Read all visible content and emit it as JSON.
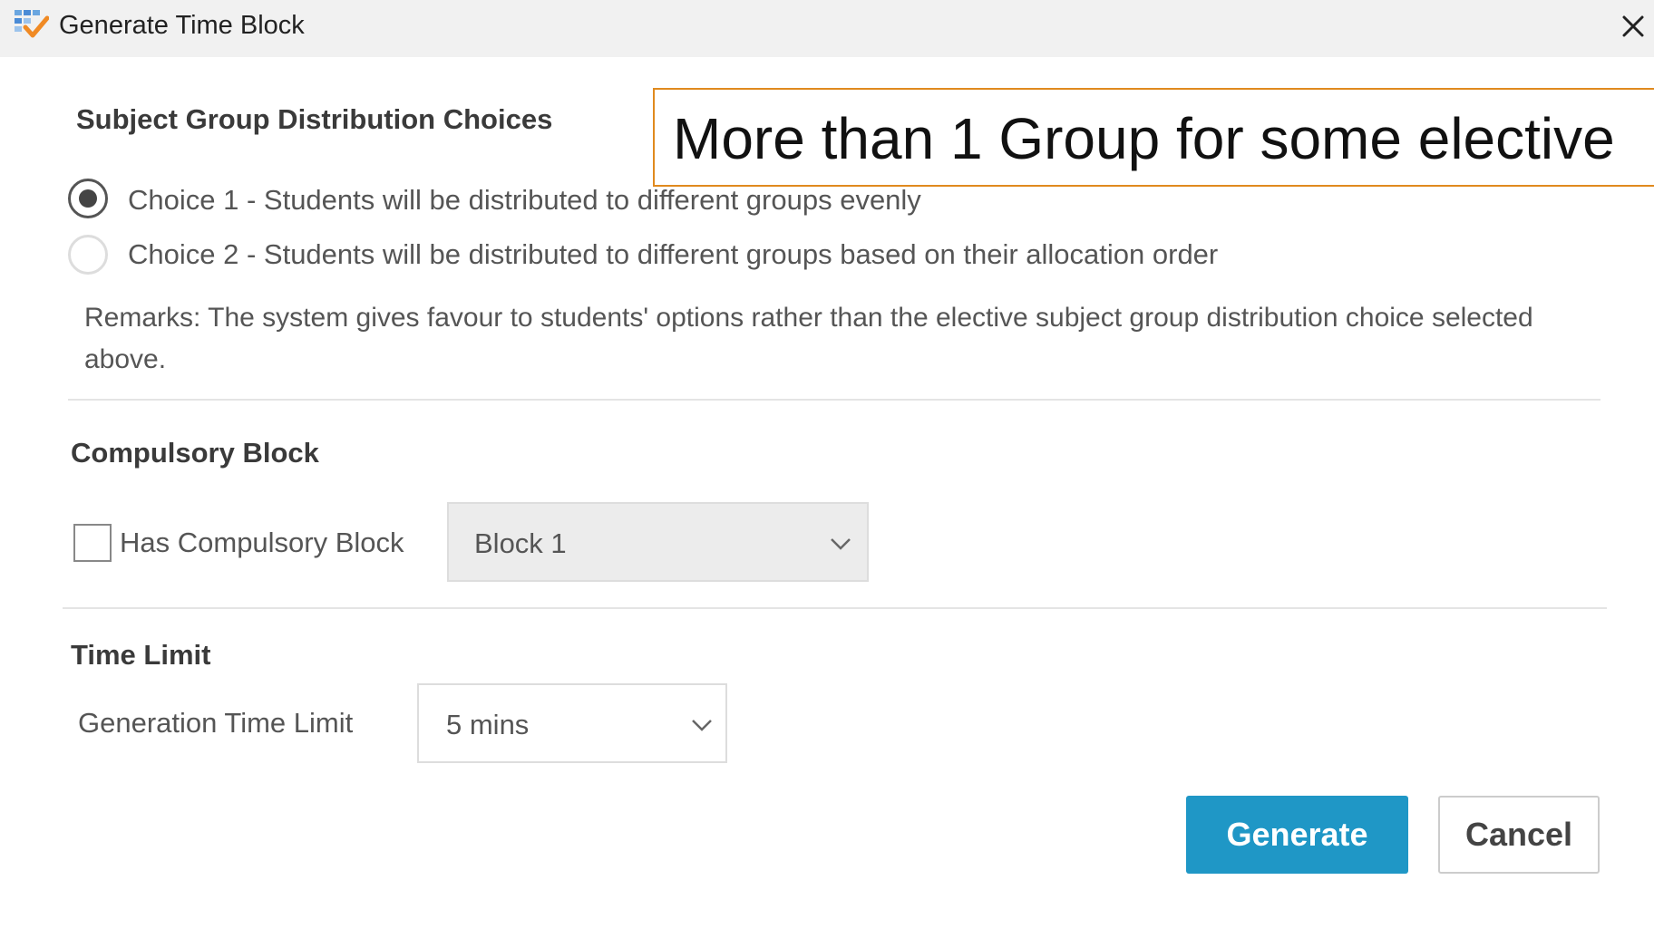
{
  "window": {
    "title": "Generate Time Block",
    "app_icon": "calendar-check-icon",
    "close_icon": "close-icon"
  },
  "annotation": {
    "text": "More than 1 Group for some elective",
    "border_color": "#e08a1e"
  },
  "distribution": {
    "title": "Subject Group Distribution Choices",
    "choices": [
      {
        "label": "Choice 1 - Students will be distributed to different groups evenly",
        "selected": true
      },
      {
        "label": "Choice 2 - Students will be distributed to different groups based on their allocation order",
        "selected": false
      }
    ],
    "remarks": "Remarks: The system gives favour to students' options rather than the elective subject group distribution choice selected above."
  },
  "compulsory": {
    "title": "Compulsory Block",
    "checkbox_label": "Has Compulsory Block",
    "checked": false,
    "block_select": {
      "value": "Block 1",
      "disabled": true
    }
  },
  "time_limit": {
    "title": "Time Limit",
    "field_label": "Generation Time Limit",
    "select_value": "5 mins"
  },
  "buttons": {
    "generate": "Generate",
    "cancel": "Cancel",
    "primary_color": "#1f97c6"
  }
}
